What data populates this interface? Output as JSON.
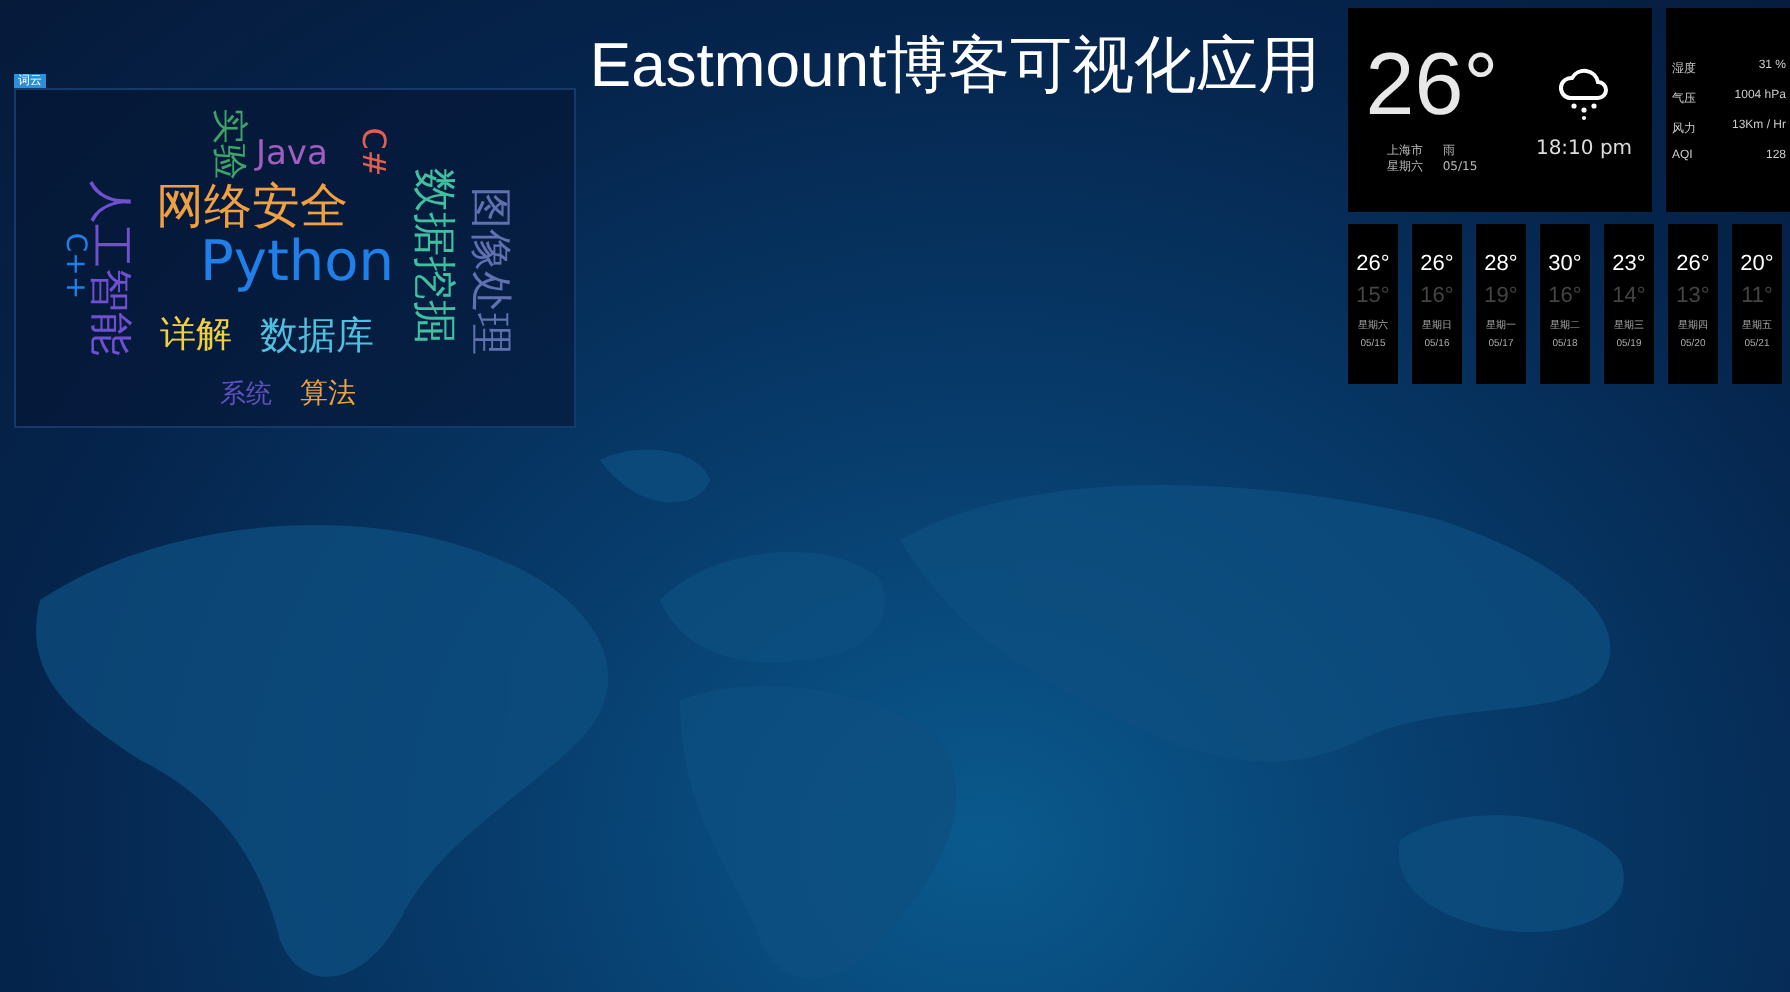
{
  "title": "Eastmount博客可视化应用",
  "word_cloud": {
    "tag": "词云",
    "words": [
      {
        "text": "实验",
        "color": "#3fa46a",
        "vertical": true
      },
      {
        "text": "Java",
        "color": "#a05fc0",
        "vertical": false
      },
      {
        "text": "C#",
        "color": "#e06050",
        "vertical": true
      },
      {
        "text": "网络安全",
        "color": "#f0a040",
        "vertical": false
      },
      {
        "text": "Python",
        "color": "#1e80e8",
        "vertical": false
      },
      {
        "text": "人工智能",
        "color": "#7050d0",
        "vertical": true
      },
      {
        "text": "C++",
        "color": "#1e80e8",
        "vertical": true
      },
      {
        "text": "数据挖掘",
        "color": "#40c0a0",
        "vertical": true
      },
      {
        "text": "图像处理",
        "color": "#6070b0",
        "vertical": true
      },
      {
        "text": "详解",
        "color": "#f0d040",
        "vertical": false
      },
      {
        "text": "数据库",
        "color": "#50c0e0",
        "vertical": false
      },
      {
        "text": "系统",
        "color": "#6050c0",
        "vertical": false
      },
      {
        "text": "算法",
        "color": "#f0a040",
        "vertical": false
      }
    ]
  },
  "weather": {
    "temperature": "26°",
    "city": "上海市",
    "condition": "雨",
    "weekday": "星期六",
    "date": "05/15",
    "time": "18:10 pm"
  },
  "stats": [
    {
      "label": "湿度",
      "value": "31 %"
    },
    {
      "label": "气压",
      "value": "1004 hPa"
    },
    {
      "label": "风力",
      "value": "13Km / Hr"
    },
    {
      "label": "AQI",
      "value": "128"
    }
  ],
  "forecast": [
    {
      "high": "26°",
      "low": "15°",
      "weekday": "星期六",
      "date": "05/15"
    },
    {
      "high": "26°",
      "low": "16°",
      "weekday": "星期日",
      "date": "05/16"
    },
    {
      "high": "28°",
      "low": "19°",
      "weekday": "星期一",
      "date": "05/17"
    },
    {
      "high": "30°",
      "low": "16°",
      "weekday": "星期二",
      "date": "05/18"
    },
    {
      "high": "23°",
      "low": "14°",
      "weekday": "星期三",
      "date": "05/19"
    },
    {
      "high": "26°",
      "low": "13°",
      "weekday": "星期四",
      "date": "05/20"
    },
    {
      "high": "20°",
      "low": "11°",
      "weekday": "星期五",
      "date": "05/21"
    }
  ]
}
